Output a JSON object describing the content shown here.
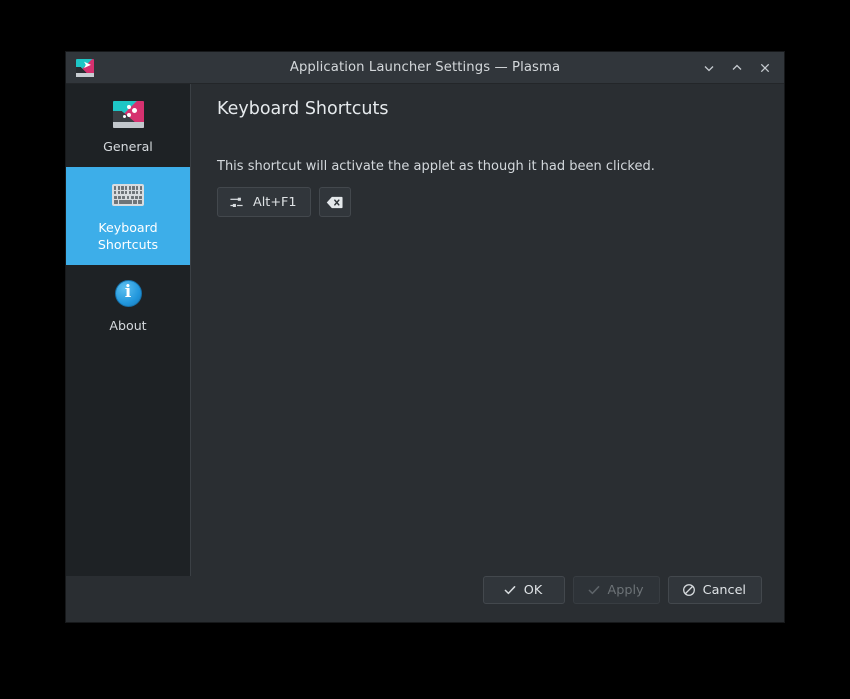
{
  "window": {
    "title": "Application Launcher Settings — Plasma",
    "app_icon": "plasma-launcher-icon",
    "controls": [
      {
        "name": "minimize-button",
        "icon": "chevron-down-icon"
      },
      {
        "name": "maximize-button",
        "icon": "chevron-up-icon"
      },
      {
        "name": "close-button",
        "icon": "close-icon"
      }
    ]
  },
  "sidebar": {
    "items": [
      {
        "label": "General",
        "icon": "plasma-launcher-icon",
        "selected": false
      },
      {
        "label": "Keyboard\nShortcuts",
        "label_line1": "Keyboard",
        "label_line2": "Shortcuts",
        "icon": "keyboard-icon",
        "selected": true
      },
      {
        "label": "About",
        "icon": "info-icon",
        "selected": false
      }
    ]
  },
  "main": {
    "page_title": "Keyboard Shortcuts",
    "shortcut": {
      "description": "This shortcut will activate the applet as though it had been clicked.",
      "value": "Alt+F1",
      "button_icon": "configure-sliders-icon",
      "clear_icon": "backspace-delete-icon"
    }
  },
  "footer": {
    "buttons": [
      {
        "label": "OK",
        "icon": "check-icon",
        "enabled": true
      },
      {
        "label": "Apply",
        "icon": "check-icon",
        "enabled": false
      },
      {
        "label": "Cancel",
        "icon": "cancel-circle-slash-icon",
        "enabled": true
      }
    ]
  },
  "colors": {
    "accent": "#3daee9",
    "window_bg": "#2a2e32",
    "sidebar_bg": "#1e2225",
    "titlebar_bg": "#31363b",
    "button_bg": "#31363b",
    "text": "#d6dade"
  }
}
